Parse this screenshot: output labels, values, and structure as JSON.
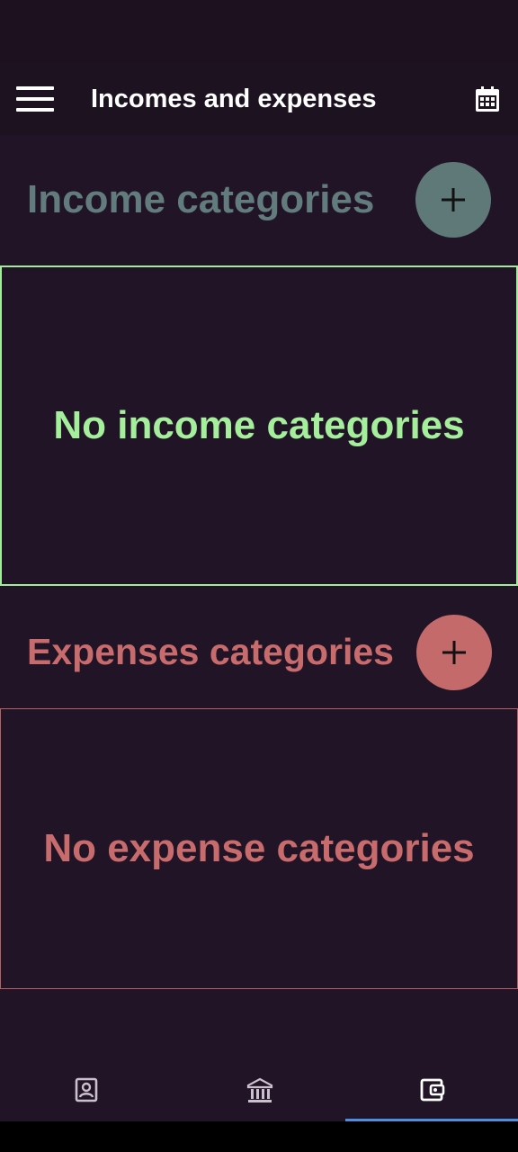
{
  "app_bar": {
    "title": "Incomes and expenses",
    "menu_icon": "hamburger-menu-icon",
    "calendar_icon": "calendar-icon"
  },
  "income": {
    "title": "Income categories",
    "add_icon": "plus-icon",
    "empty_text": "No income categories",
    "color": "#627b7c",
    "border_color": "#a2eb9a"
  },
  "expense": {
    "title": "Expenses categories",
    "add_icon": "plus-icon",
    "empty_text": "No expense categories",
    "color": "#c86b6c",
    "border_color": "#b46162"
  },
  "bottom_nav": {
    "items": [
      {
        "icon": "contact-card-icon",
        "selected": false
      },
      {
        "icon": "bank-icon",
        "selected": false
      },
      {
        "icon": "wallet-icon",
        "selected": true
      }
    ],
    "indicator_color": "#4a8fe0"
  },
  "colors": {
    "background": "#211426",
    "app_bar": "#1d121f"
  }
}
